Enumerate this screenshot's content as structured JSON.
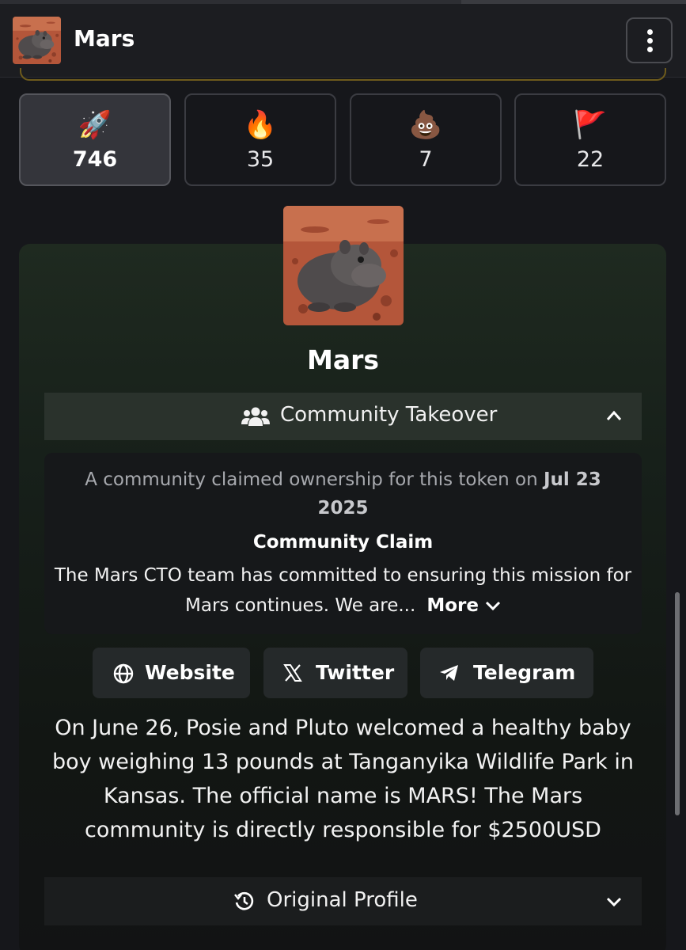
{
  "header": {
    "title": "Mars"
  },
  "reactions": [
    {
      "icon": "rocket-icon",
      "emoji": "🚀",
      "count": "746"
    },
    {
      "icon": "fire-icon",
      "emoji": "🔥",
      "count": "35"
    },
    {
      "icon": "poop-icon",
      "emoji": "💩",
      "count": "7"
    },
    {
      "icon": "red-flag-icon",
      "emoji": "🚩",
      "count": "22"
    }
  ],
  "token": {
    "name": "Mars"
  },
  "cto": {
    "label": "Community Takeover",
    "claim_prefix": "A community claimed ownership for this token on ",
    "claim_date": "Jul 23 2025",
    "claim_title": "Community Claim",
    "claim_body": "The Mars CTO team has committed to ensuring this mission for Mars continues. We are...",
    "more_label": "More"
  },
  "links": {
    "website": "Website",
    "twitter": "Twitter",
    "telegram": "Telegram"
  },
  "description": "On June 26, Posie and Pluto welcomed a healthy baby boy weighing 13 pounds at Tanganyika Wildlife Park in Kansas. The official name is MARS! The Mars community is directly responsible for $2500USD",
  "original_profile": {
    "label": "Original Profile"
  },
  "colors": {
    "background": "#16171b",
    "active_reaction": "#34353b",
    "cto_bar": "#2a322c",
    "gold_accent": "#6e5b1c"
  }
}
